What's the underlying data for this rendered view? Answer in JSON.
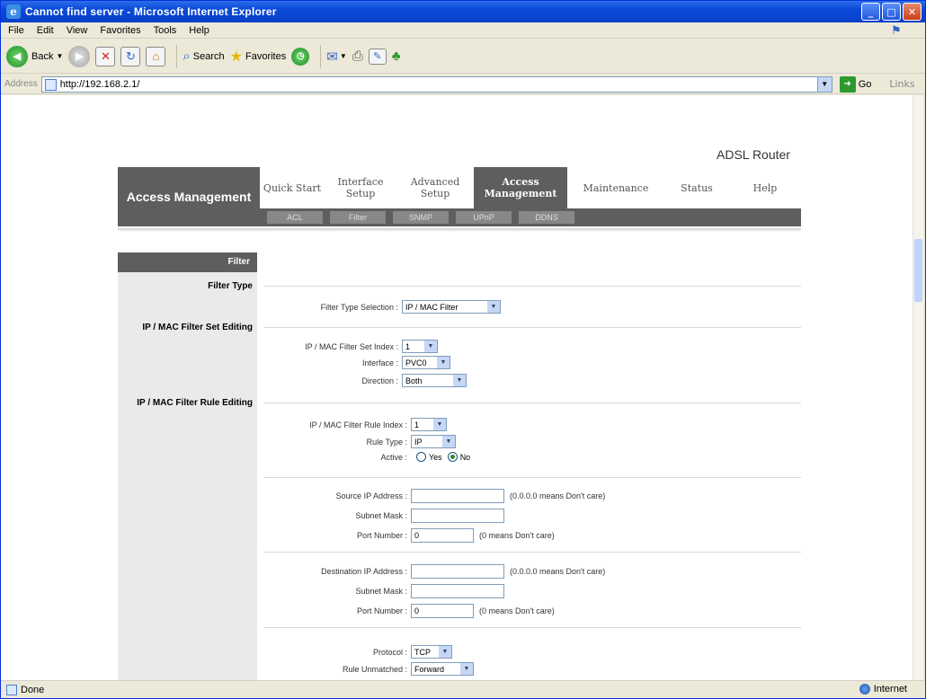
{
  "window": {
    "title": "Cannot find server - Microsoft Internet Explorer"
  },
  "menu": [
    "File",
    "Edit",
    "View",
    "Favorites",
    "Tools",
    "Help"
  ],
  "toolbar": {
    "back": "Back",
    "search": "Search",
    "favorites": "Favorites"
  },
  "address": {
    "label": "Address",
    "url": "http://192.168.2.1/",
    "go": "Go",
    "links": "Links"
  },
  "status": {
    "left": "Done",
    "zone": "Internet"
  },
  "page": {
    "brand": "ADSL Router",
    "section": "Access Management",
    "tabs": [
      {
        "label": "Quick Start"
      },
      {
        "label": "Interface Setup"
      },
      {
        "label": "Advanced Setup"
      },
      {
        "label": "Access Management"
      },
      {
        "label": "Maintenance"
      },
      {
        "label": "Status"
      },
      {
        "label": "Help"
      }
    ],
    "subtabs": [
      "ACL",
      "Filter",
      "SNMP",
      "UPnP",
      "DDNS"
    ],
    "sidebar_head": "Filter",
    "sections": {
      "filter_type": "Filter Type",
      "set_editing": "IP / MAC Filter Set Editing",
      "rule_editing": "IP / MAC Filter Rule Editing"
    },
    "fields": {
      "filter_type_selection": {
        "label": "Filter Type Selection :",
        "value": "IP / MAC Filter"
      },
      "set_index": {
        "label": "IP / MAC Filter Set Index :",
        "value": "1"
      },
      "interface": {
        "label": "Interface :",
        "value": "PVC0"
      },
      "direction": {
        "label": "Direction :",
        "value": "Both"
      },
      "rule_index": {
        "label": "IP / MAC Filter Rule Index :",
        "value": "1"
      },
      "rule_type": {
        "label": "Rule Type :",
        "value": "IP"
      },
      "active": {
        "label": "Active :",
        "yes": "Yes",
        "no": "No",
        "selected": "No"
      },
      "src_ip": {
        "label": "Source IP Address :",
        "value": "",
        "note": "(0.0.0.0 means Don't care)"
      },
      "src_mask": {
        "label": "Subnet Mask :",
        "value": ""
      },
      "src_port": {
        "label": "Port Number :",
        "value": "0",
        "note": "(0 means Don't care)"
      },
      "dst_ip": {
        "label": "Destination IP Address :",
        "value": "",
        "note": "(0.0.0.0 means Don't care)"
      },
      "dst_mask": {
        "label": "Subnet Mask :",
        "value": ""
      },
      "dst_port": {
        "label": "Port Number :",
        "value": "0",
        "note": "(0 means Don't care)"
      },
      "protocol": {
        "label": "Protocol :",
        "value": "TCP"
      },
      "unmatched": {
        "label": "Rule Unmatched :",
        "value": "Forward"
      }
    }
  }
}
